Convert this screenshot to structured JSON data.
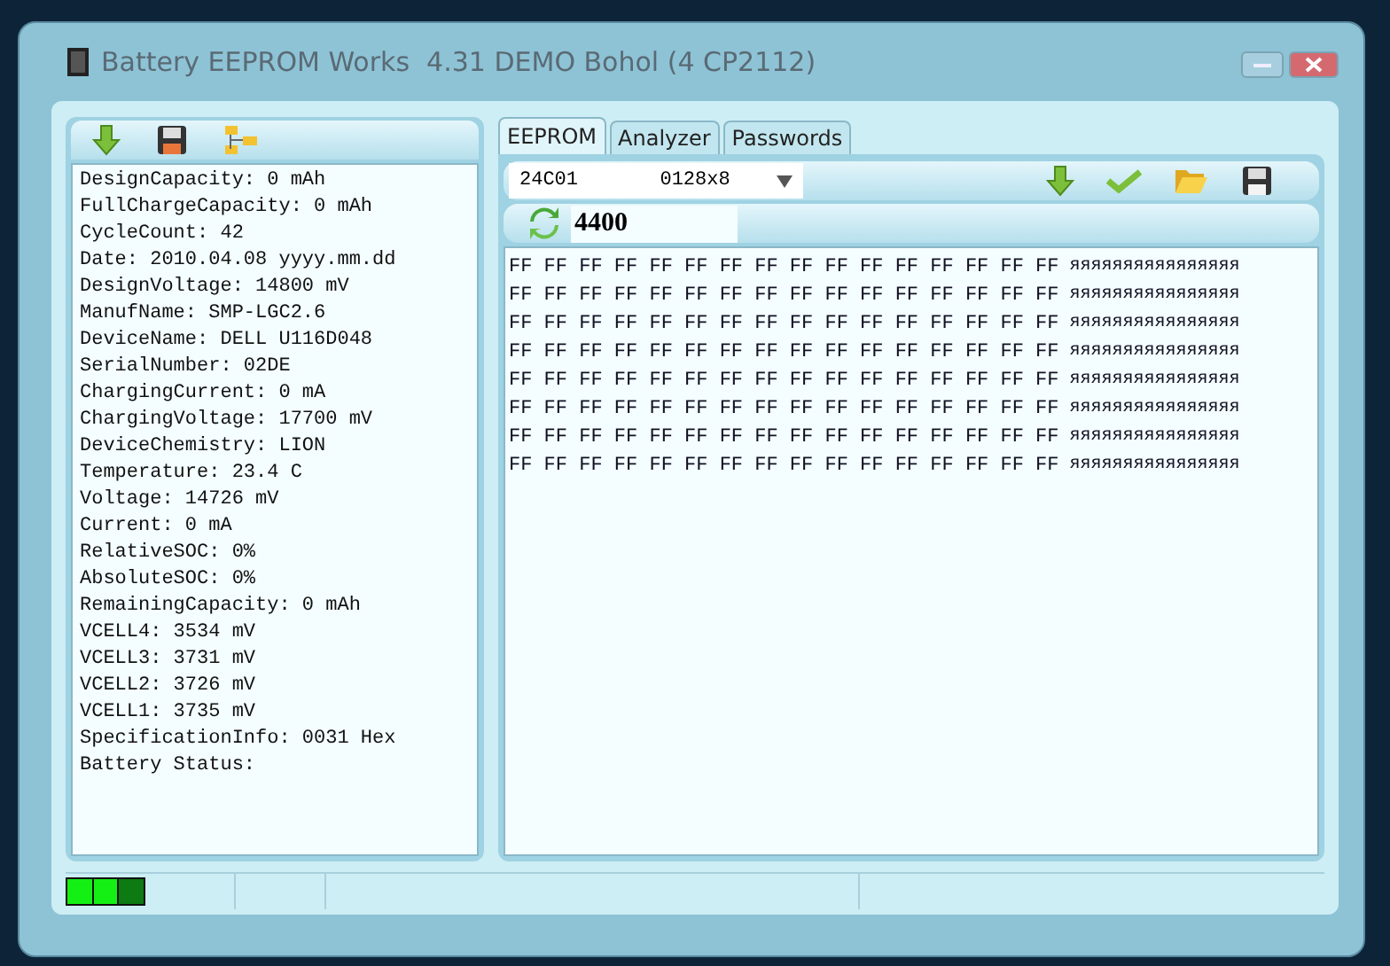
{
  "window": {
    "title": "Battery EEPROM Works  4.31 DEMO Bohol (4 CP2112)"
  },
  "info_lines": [
    "DesignCapacity: 0 mAh",
    "FullChargeCapacity: 0 mAh",
    "CycleCount: 42",
    "Date: 2010.04.08 yyyy.mm.dd",
    "DesignVoltage: 14800 mV",
    "ManufName: SMP-LGC2.6",
    "DeviceName: DELL U116D048",
    "SerialNumber: 02DE",
    "ChargingCurrent: 0 mA",
    "ChargingVoltage: 17700 mV",
    "DeviceChemistry: LION",
    "Temperature: 23.4 C",
    "Voltage: 14726 mV",
    "Current: 0 mA",
    "RelativeSOC: 0%",
    "AbsoluteSOC: 0%",
    "RemainingCapacity: 0 mAh",
    "VCELL4: 3534 mV",
    "VCELL3: 3731 mV",
    "VCELL2: 3726 mV",
    "VCELL1: 3735 mV",
    "SpecificationInfo: 0031 Hex",
    "Battery Status:"
  ],
  "tabs": [
    {
      "label": "EEPROM",
      "selected": true
    },
    {
      "label": "Analyzer",
      "selected": false
    },
    {
      "label": "Passwords",
      "selected": false
    }
  ],
  "chip_select": {
    "value": "24C01       0128x8"
  },
  "address_field": {
    "value": "4400"
  },
  "hex_rows": [
    {
      "hex": "FF FF FF FF FF FF FF FF FF FF FF FF FF FF FF FF",
      "ascii": "яяяяяяяяяяяяяяяя"
    },
    {
      "hex": "FF FF FF FF FF FF FF FF FF FF FF FF FF FF FF FF",
      "ascii": "яяяяяяяяяяяяяяяя"
    },
    {
      "hex": "FF FF FF FF FF FF FF FF FF FF FF FF FF FF FF FF",
      "ascii": "яяяяяяяяяяяяяяяя"
    },
    {
      "hex": "FF FF FF FF FF FF FF FF FF FF FF FF FF FF FF FF",
      "ascii": "яяяяяяяяяяяяяяяя"
    },
    {
      "hex": "FF FF FF FF FF FF FF FF FF FF FF FF FF FF FF FF",
      "ascii": "яяяяяяяяяяяяяяяя"
    },
    {
      "hex": "FF FF FF FF FF FF FF FF FF FF FF FF FF FF FF FF",
      "ascii": "яяяяяяяяяяяяяяяя"
    },
    {
      "hex": "FF FF FF FF FF FF FF FF FF FF FF FF FF FF FF FF",
      "ascii": "яяяяяяяяяяяяяяяя"
    },
    {
      "hex": "FF FF FF FF FF FF FF FF FF FF FF FF FF FF FF FF",
      "ascii": "яяяяяяяяяяяяяяяя"
    }
  ],
  "status_bar": {
    "indicator": [
      {
        "on": true
      },
      {
        "on": true
      },
      {
        "on": false
      }
    ]
  }
}
